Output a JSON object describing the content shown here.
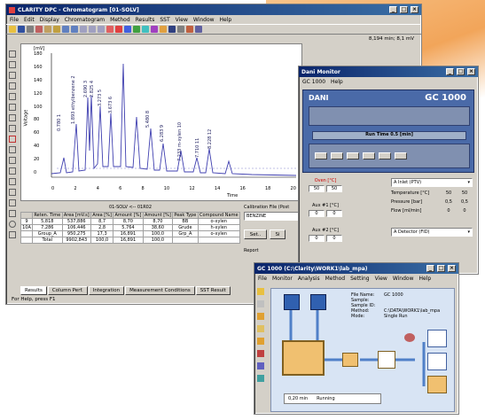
{
  "chrom": {
    "title": "CLARITY DPC - Chromatogram [01-SOLV]",
    "menu": [
      "File",
      "Edit",
      "Display",
      "Chromatogram",
      "Method",
      "Results",
      "SST",
      "View",
      "Window",
      "Help"
    ],
    "toolbar_readout": "8,194 min; 8,1 mV",
    "y_unit": "[mV]",
    "y_axis_label": "Voltage",
    "x_axis_label": "Time",
    "y_ticks": [
      "180",
      "160",
      "140",
      "120",
      "100",
      "80",
      "60",
      "40",
      "20",
      "0"
    ],
    "x_ticks": [
      "0",
      "2",
      "4",
      "6",
      "8",
      "10",
      "12",
      "14",
      "16",
      "18",
      "20"
    ],
    "peak_labels": [
      "0.780 1",
      "1.893 ethylbenzene 2",
      "2.690 3",
      "2.825 4",
      "3.273 5",
      "3.673 6",
      "5.480 8",
      "6.283 9",
      "7.233 m-xylen 10",
      "7.710 11",
      "8.228 12"
    ],
    "results_caption": "01-SOLV <-- 01R02",
    "results_table": {
      "headers": [
        "",
        "Reten. Time",
        "Area [mV.s]",
        "Area [%]",
        "Amount [%]",
        "Amount [%]",
        "Peak Type",
        "Compound Name"
      ],
      "rows": [
        [
          "9",
          "5,818",
          "537,886",
          "8,7",
          "8,70",
          "8,70",
          "BB",
          "o-xylen"
        ],
        [
          "10A",
          "7,286",
          "106,446",
          "2,8",
          "5,764",
          "38,60",
          "Grude",
          "h-xylen"
        ],
        [
          "",
          "Group_A",
          "950,275",
          "17,3",
          "16,891",
          "100,0",
          "Grp_A",
          "o-xylen"
        ],
        [
          "",
          "Total",
          "9902,843",
          "100,0",
          "16,891",
          "100,0",
          "",
          " "
        ]
      ]
    },
    "calib_label": "Calibration File (Post",
    "calib_value": "BENZINE",
    "calib_buttons": [
      "Set..",
      "Si"
    ],
    "report_label": "Report",
    "tabs": [
      "Results",
      "Column Perf.",
      "Integration",
      "Measurement Conditions",
      "SST Result"
    ],
    "status": "For Help, press F1"
  },
  "monitor": {
    "title": "Dani Monitor",
    "menu": [
      "GC 1000",
      "Help"
    ],
    "brand": "DANI",
    "model": "GC 1000",
    "run_time_label": "Run Time 0.5 [min]",
    "oven_label": "Oven [°C]",
    "oven_values": [
      "50",
      "50"
    ],
    "aux1_label": "Aux #1 [°C]",
    "aux1_values": [
      "0",
      "0"
    ],
    "aux2_label": "Aux #2 [°C]",
    "aux2_values": [
      "0",
      "0"
    ],
    "inlet_select": "A Inlet (PTV)",
    "detector_select": "A Detector (FID)",
    "params": [
      {
        "label": "Temperature [°C]",
        "a": "50",
        "b": "50"
      },
      {
        "label": "Pressure [bar]",
        "a": "0,5",
        "b": "0,5"
      },
      {
        "label": "Flow [ml/min]",
        "a": "0",
        "b": "0"
      }
    ]
  },
  "instrument": {
    "title": "GC 1000 (C:\\Clarity\\WORK1\\lab_mpa)",
    "menu": [
      "File",
      "Monitor",
      "Analysis",
      "Method",
      "Setting",
      "View",
      "Window",
      "Help"
    ],
    "info": [
      {
        "k": "File Name:",
        "v": "GC 1000"
      },
      {
        "k": "Sample:",
        "v": ""
      },
      {
        "k": "Sample ID:",
        "v": ""
      },
      {
        "k": "Method:",
        "v": "C:\\DATA\\WORK1\\lab_mpa"
      },
      {
        "k": "Mode:",
        "v": "Single Run"
      }
    ],
    "run_time": "0,20 min",
    "run_state": "Running"
  },
  "colors": {
    "titlebar": "#0a246a",
    "window_bg": "#d4d0c8",
    "trace": "#4040b0",
    "gc_panel": "#4a6aa8",
    "accent_orange": "#f2a55a"
  }
}
